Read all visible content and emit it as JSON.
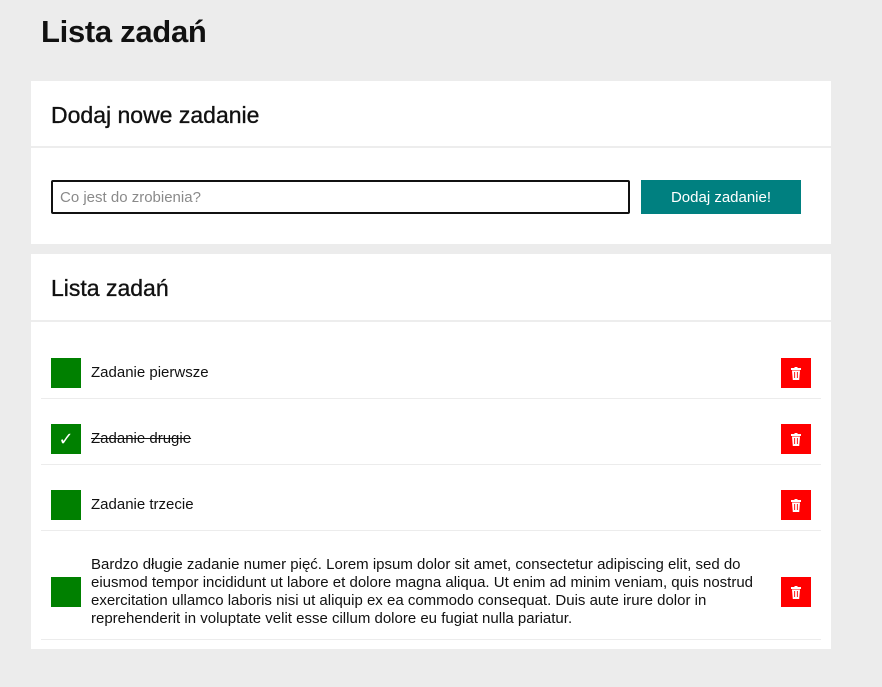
{
  "page": {
    "title": "Lista zadań"
  },
  "add_card": {
    "heading": "Dodaj nowe zadanie",
    "input_value": "",
    "input_placeholder": "Co jest do zrobienia?",
    "button_label": "Dodaj zadanie!"
  },
  "list_card": {
    "heading": "Lista zadań",
    "tasks": [
      {
        "text": "Zadanie pierwsze",
        "done": false,
        "check_mark": ""
      },
      {
        "text": "Zadanie drugie",
        "done": true,
        "check_mark": "✓"
      },
      {
        "text": "Zadanie trzecie",
        "done": false,
        "check_mark": ""
      },
      {
        "text": "Bardzo długie zadanie numer pięć. Lorem ipsum dolor sit amet, consectetur adipiscing elit, sed do eiusmod tempor incididunt ut labore et dolore magna aliqua. Ut enim ad minim veniam, quis nostrud exercitation ullamco laboris nisi ut aliquip ex ea commodo consequat. Duis aute irure dolor in reprehenderit in voluptate velit esse cillum dolore eu fugiat nulla pariatur.",
        "done": false,
        "check_mark": ""
      }
    ]
  },
  "icons": {
    "checkbox": "checkbox-icon",
    "check": "check-icon",
    "delete": "trash-icon"
  },
  "colors": {
    "checkbox": "#008000",
    "add_button": "#008080",
    "delete_button": "#ff0000",
    "background": "#ececec",
    "card": "#ffffff"
  }
}
